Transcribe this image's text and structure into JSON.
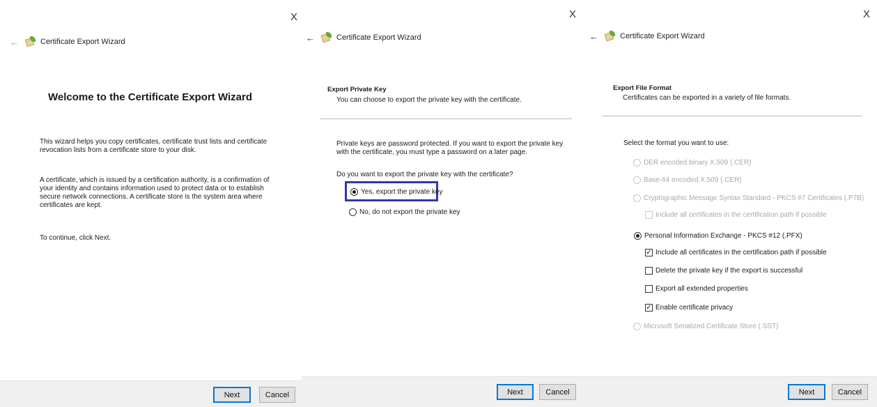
{
  "common": {
    "close_glyph": "X",
    "back_glyph": "←",
    "wizard_title": "Certificate Export Wizard",
    "next_label": "Next",
    "cancel_label": "Cancel"
  },
  "panel1": {
    "heading": "Welcome to the Certificate Export Wizard",
    "para1": "This wizard helps you copy certificates, certificate trust lists and certificate revocation lists from a certificate store to your disk.",
    "para2": "A certificate, which is issued by a certification authority, is a confirmation of your identity and contains information used to protect data or to establish secure network connections. A certificate store is the system area where certificates are kept.",
    "para3": "To continue, click Next."
  },
  "panel2": {
    "section_title": "Export Private Key",
    "section_sub": "You can choose to export the private key with the certificate.",
    "para1": "Private keys are password protected. If you want to export the private key with the certificate, you must type a password on a later page.",
    "question": "Do you want to export the private key with the certificate?",
    "option_yes": "Yes, export the private key",
    "option_no": "No, do not export the private key"
  },
  "panel3": {
    "section_title": "Export File Format",
    "section_sub": "Certificates can be exported in a variety of file formats.",
    "prompt": "Select the format you want to use:",
    "opt_der": "DER encoded binary X.509 (.CER)",
    "opt_base64": "Base-64 encoded X.509 (.CER)",
    "opt_pkcs7": "Cryptographic Message Syntax Standard - PKCS #7 Certificates (.P7B)",
    "chk_pkcs7_include": "Include all certificates in the certification path if possible",
    "opt_pfx": "Personal Information Exchange - PKCS #12 (.PFX)",
    "chk_include": "Include all certificates in the certification path if possible",
    "chk_delete": "Delete the private key if the export is successful",
    "chk_extended": "Export all extended properties",
    "chk_privacy": "Enable certificate privacy",
    "opt_sst": "Microsoft Serialized Certificate Store (.SST)"
  },
  "colors": {
    "highlight_border": "#2b3aa8",
    "primary_button_border": "#0078d7",
    "footer_bg": "#f0f0f0"
  }
}
